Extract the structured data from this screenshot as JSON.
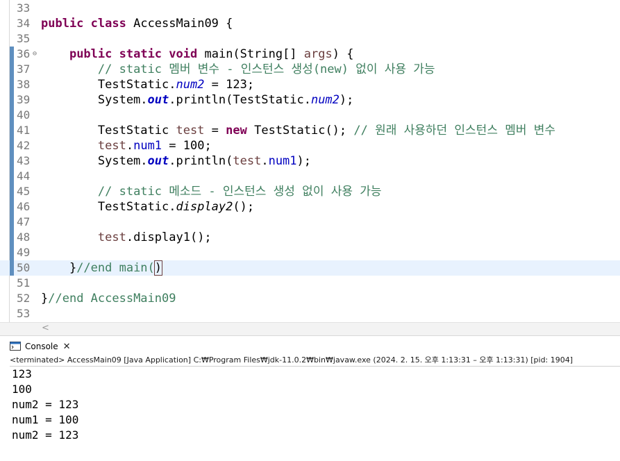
{
  "editor": {
    "lines": [
      {
        "n": "33",
        "segs": []
      },
      {
        "n": "34",
        "segs": [
          [
            "kw",
            "public"
          ],
          [
            "p",
            " "
          ],
          [
            "kw",
            "class"
          ],
          [
            "p",
            " AccessMain09 {"
          ]
        ]
      },
      {
        "n": "35",
        "segs": []
      },
      {
        "n": "36",
        "fold": true,
        "segs": [
          [
            "p",
            "    "
          ],
          [
            "kw",
            "public"
          ],
          [
            "p",
            " "
          ],
          [
            "kw",
            "static"
          ],
          [
            "p",
            " "
          ],
          [
            "kw",
            "void"
          ],
          [
            "p",
            " main(String[] "
          ],
          [
            "loc",
            "args"
          ],
          [
            "p",
            ") {"
          ]
        ]
      },
      {
        "n": "37",
        "segs": [
          [
            "p",
            "        "
          ],
          [
            "cm",
            "// static 멤버 변수 - 인스턴스 생성(new) 없이 사용 가능"
          ]
        ]
      },
      {
        "n": "38",
        "segs": [
          [
            "p",
            "        TestStatic."
          ],
          [
            "fld",
            "num2"
          ],
          [
            "p",
            " = 123;"
          ]
        ]
      },
      {
        "n": "39",
        "segs": [
          [
            "p",
            "        System."
          ],
          [
            "sfld",
            "out"
          ],
          [
            "p",
            ".println(TestStatic."
          ],
          [
            "fld",
            "num2"
          ],
          [
            "p",
            ");"
          ]
        ]
      },
      {
        "n": "40",
        "segs": []
      },
      {
        "n": "41",
        "segs": [
          [
            "p",
            "        TestStatic "
          ],
          [
            "loc",
            "test"
          ],
          [
            "p",
            " = "
          ],
          [
            "kw",
            "new"
          ],
          [
            "p",
            " TestStatic(); "
          ],
          [
            "cm",
            "// 원래 사용하던 인스턴스 멤버 변수"
          ]
        ]
      },
      {
        "n": "42",
        "segs": [
          [
            "p",
            "        "
          ],
          [
            "loc",
            "test"
          ],
          [
            "p",
            "."
          ],
          [
            "ifld",
            "num1"
          ],
          [
            "p",
            " = 100;"
          ]
        ]
      },
      {
        "n": "43",
        "segs": [
          [
            "p",
            "        System."
          ],
          [
            "sfld",
            "out"
          ],
          [
            "p",
            ".println("
          ],
          [
            "loc",
            "test"
          ],
          [
            "p",
            "."
          ],
          [
            "ifld",
            "num1"
          ],
          [
            "p",
            ");"
          ]
        ]
      },
      {
        "n": "44",
        "segs": []
      },
      {
        "n": "45",
        "segs": [
          [
            "p",
            "        "
          ],
          [
            "cm",
            "// static 메소드 - 인스턴스 생성 없이 사용 가능"
          ]
        ]
      },
      {
        "n": "46",
        "segs": [
          [
            "p",
            "        TestStatic."
          ],
          [
            "it",
            "display2"
          ],
          [
            "p",
            "();"
          ]
        ]
      },
      {
        "n": "47",
        "segs": []
      },
      {
        "n": "48",
        "segs": [
          [
            "p",
            "        "
          ],
          [
            "loc",
            "test"
          ],
          [
            "p",
            ".display1();"
          ]
        ]
      },
      {
        "n": "49",
        "segs": []
      },
      {
        "n": "50",
        "current": true,
        "segs": [
          [
            "p",
            "    }"
          ],
          [
            "cm",
            "//end main("
          ],
          [
            "box",
            ")"
          ]
        ]
      },
      {
        "n": "51",
        "segs": []
      },
      {
        "n": "52",
        "segs": [
          [
            "p",
            "}"
          ],
          [
            "cm",
            "//end AccessMain09"
          ]
        ]
      },
      {
        "n": "53",
        "segs": []
      }
    ],
    "markers": [
      "36",
      "37",
      "38",
      "39",
      "40",
      "41",
      "42",
      "43",
      "44",
      "45",
      "46",
      "47",
      "48",
      "49",
      "50"
    ]
  },
  "scrollbar": {
    "left_arrow": "<"
  },
  "console": {
    "tab_label": "Console",
    "close_glyph": "✕",
    "status": "<terminated> AccessMain09 [Java Application] C:₩Program Files₩jdk-11.0.2₩bin₩javaw.exe  (2024. 2. 15. 오후 1:13:31 – 오후 1:13:31) [pid: 1904]",
    "output": [
      "123",
      "100",
      "num2 = 123",
      "num1 = 100",
      "num2 = 123"
    ]
  },
  "colors": {
    "keyword": "#7f0055",
    "comment": "#3f7f5f",
    "field": "#0000c0",
    "local": "#6a3e3e",
    "current_line": "#e8f2fe",
    "change_marker": "#5f8fbf"
  }
}
